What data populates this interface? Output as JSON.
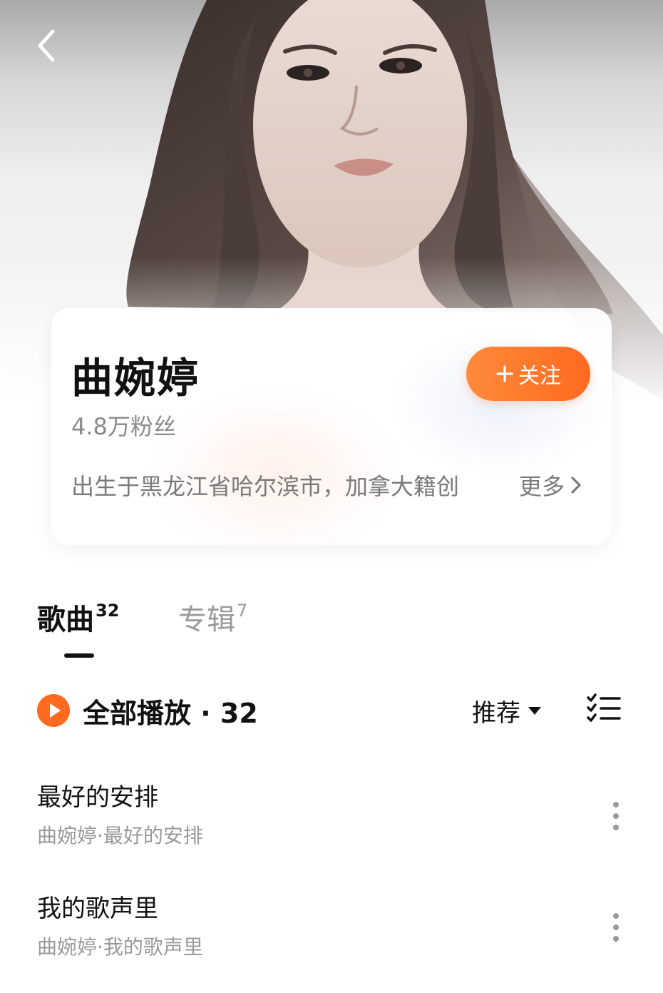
{
  "artist": {
    "name": "曲婉婷",
    "fans": "4.8万粉丝",
    "bio": "出生于黑龙江省哈尔滨市，加拿大籍创",
    "more_label": "更多",
    "follow_label": "关注"
  },
  "tabs": [
    {
      "label": "歌曲",
      "count": "32",
      "active": true
    },
    {
      "label": "专辑",
      "count": "7",
      "active": false
    }
  ],
  "play_all": {
    "label": "全部播放 · 32"
  },
  "sort": {
    "label": "推荐"
  },
  "songs": [
    {
      "title": "最好的安排",
      "subtitle": "曲婉婷·最好的安排"
    },
    {
      "title": "我的歌声里",
      "subtitle": "曲婉婷·我的歌声里"
    }
  ],
  "colors": {
    "accent": "#ff6a20",
    "text_primary": "#111111",
    "text_secondary": "#9a9a9a"
  },
  "icons": {
    "back": "chevron-left-icon",
    "follow": "plus-icon",
    "more": "chevron-right-icon",
    "play": "play-circle-icon",
    "sort": "caret-down-icon",
    "multiselect": "checklist-icon",
    "song_more": "vertical-dots-icon"
  }
}
